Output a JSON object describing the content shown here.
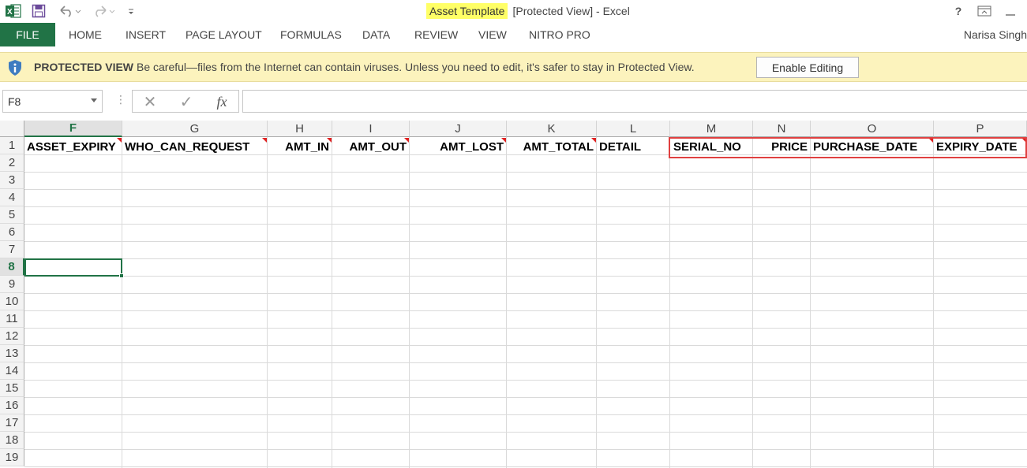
{
  "titlebar": {
    "document_name": "Asset Template",
    "title_rest": "[Protected View] - Excel",
    "help_label": "?",
    "icons": [
      "excel-logo-icon",
      "save-icon",
      "undo-icon",
      "redo-icon",
      "customize-qat-icon",
      "ribbon-display-icon"
    ]
  },
  "ribbon": {
    "file_tab": "FILE",
    "tabs": [
      "HOME",
      "INSERT",
      "PAGE LAYOUT",
      "FORMULAS",
      "DATA",
      "REVIEW",
      "VIEW",
      "NITRO PRO"
    ],
    "user_name": "Narisa Singh"
  },
  "protected_view": {
    "title": "PROTECTED VIEW",
    "message": "Be careful—files from the Internet can contain viruses. Unless you need to edit, it's safer to stay in Protected View.",
    "button_label": "Enable Editing",
    "icon": "shield-info-icon"
  },
  "formula_bar": {
    "name_box": "F8",
    "dots": "⋮",
    "cancel_icon": "✕",
    "enter_icon": "✓",
    "function_label": "fx",
    "formula": ""
  },
  "sheet": {
    "columns": [
      "F",
      "G",
      "H",
      "I",
      "J",
      "K",
      "L",
      "M",
      "N",
      "O",
      "P"
    ],
    "selected_column": "F",
    "rows": [
      "1",
      "2",
      "3",
      "4",
      "5",
      "6",
      "7",
      "8",
      "9",
      "10",
      "11",
      "12",
      "13",
      "14",
      "15",
      "16",
      "17",
      "18",
      "19"
    ],
    "selected_row": "8",
    "row1_cells": [
      "ASSET_EXPIRY",
      "WHO_CAN_REQUEST",
      "AMT_IN",
      "AMT_OUT",
      "AMT_LOST",
      "AMT_TOTAL",
      "DETAIL",
      "SERIAL_NO",
      "PRICE",
      "PURCHASE_DATE",
      "EXPIRY_DATE"
    ],
    "cells_with_comments": [
      "F1",
      "G1",
      "H1",
      "I1",
      "J1",
      "K1",
      "O1",
      "P1"
    ],
    "highlighted_range": "M1:P1",
    "highlight_color": "#e04040",
    "accent_color": "#217346"
  }
}
